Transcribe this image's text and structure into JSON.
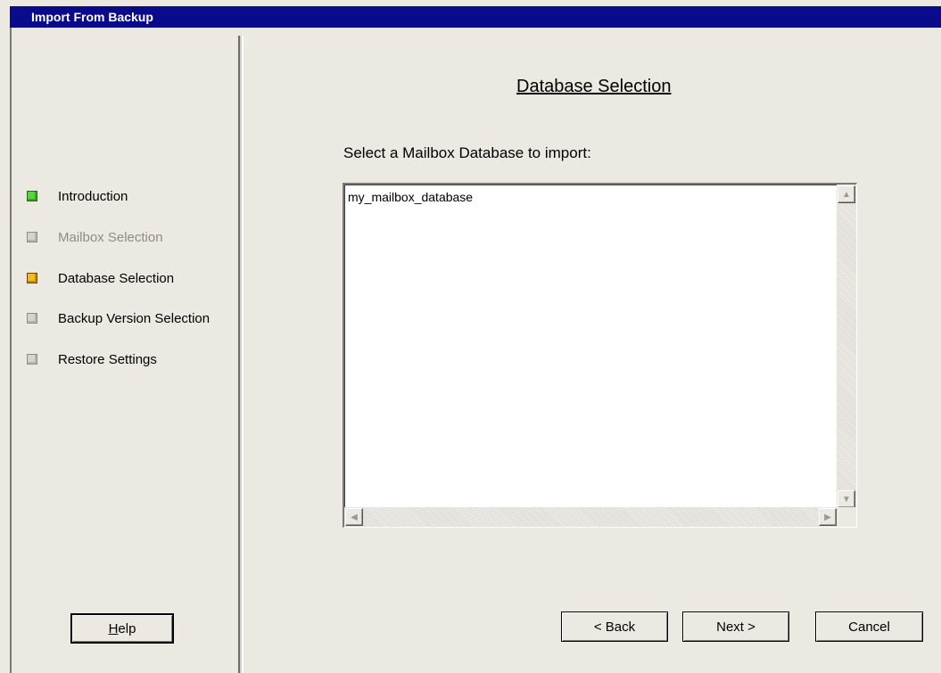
{
  "window": {
    "title": "Import From Backup"
  },
  "steps": [
    {
      "label": "Introduction",
      "state": "done",
      "color": "#56d63a"
    },
    {
      "label": "Mailbox Selection",
      "state": "disabled",
      "color": "#d6d3cc"
    },
    {
      "label": "Database Selection",
      "state": "current",
      "color": "#f2bc1a"
    },
    {
      "label": "Backup Version Selection",
      "state": "pending",
      "color": "#d6d3cc"
    },
    {
      "label": "Restore Settings",
      "state": "pending",
      "color": "#d6d3cc"
    }
  ],
  "main": {
    "title": "Database Selection",
    "prompt": "Select a Mailbox Database to import:",
    "databases": [
      "my_mailbox_database"
    ]
  },
  "buttons": {
    "help": "Help",
    "back": "< Back",
    "next": "Next >",
    "cancel": "Cancel"
  },
  "icons": {
    "scroll_up": "triangle-up-icon",
    "scroll_down": "triangle-down-icon",
    "scroll_left": "triangle-left-icon",
    "scroll_right": "triangle-right-icon"
  },
  "colors": {
    "titlebar": "#0a0a8c",
    "background": "#ece9e3"
  }
}
